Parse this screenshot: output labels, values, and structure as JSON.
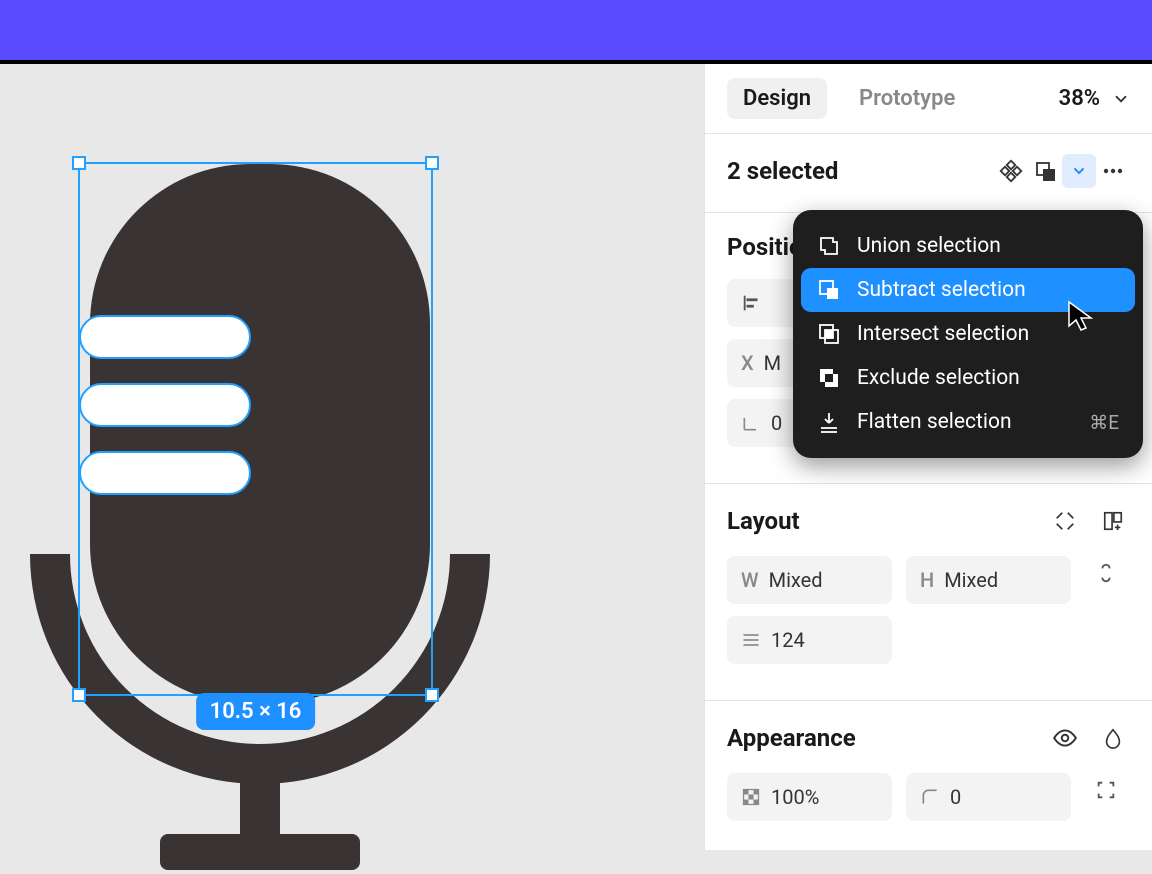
{
  "tabs": {
    "design": "Design",
    "prototype": "Prototype"
  },
  "zoom": "38%",
  "selection": {
    "count_label": "2 selected",
    "dimensions": "10.5 × 16"
  },
  "position_section": {
    "title": "Position"
  },
  "layout_section": {
    "title": "Layout",
    "w_label": "W",
    "w_value": "Mixed",
    "h_label": "H",
    "h_value": "Mixed",
    "gap_value": "124"
  },
  "appearance_section": {
    "title": "Appearance",
    "opacity": "100%",
    "corner": "0"
  },
  "boolean_menu": {
    "union": "Union selection",
    "subtract": "Subtract selection",
    "intersect": "Intersect selection",
    "exclude": "Exclude selection",
    "flatten": "Flatten selection",
    "flatten_shortcut": "⌘E"
  }
}
